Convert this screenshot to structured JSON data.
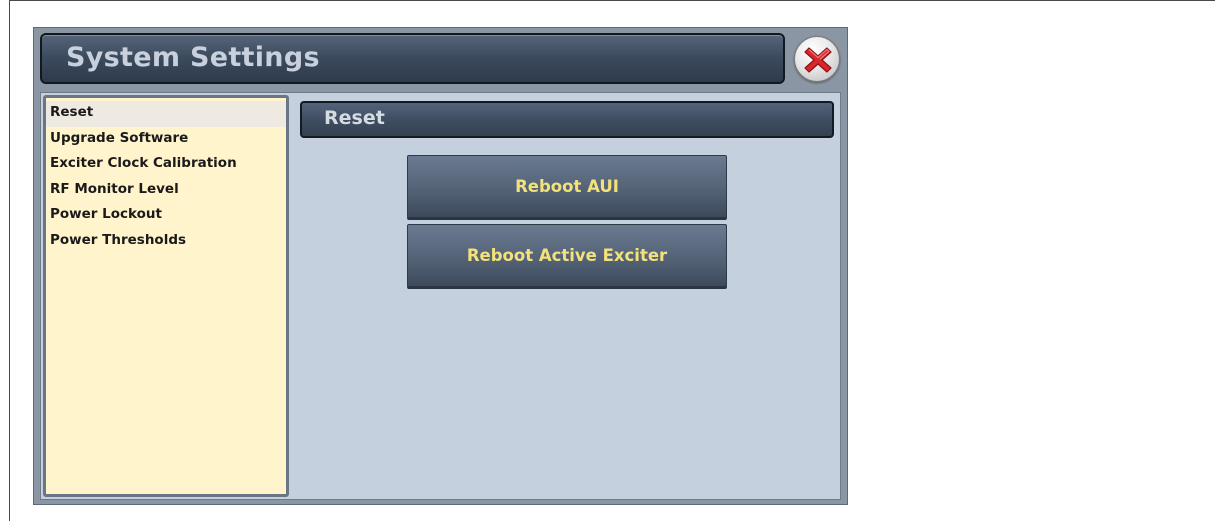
{
  "window": {
    "title": "System Settings",
    "close_icon": "close-x-icon"
  },
  "sidebar": {
    "items": [
      {
        "label": "Reset",
        "selected": true
      },
      {
        "label": "Upgrade Software",
        "selected": false
      },
      {
        "label": "Exciter Clock Calibration",
        "selected": false
      },
      {
        "label": "RF Monitor Level",
        "selected": false
      },
      {
        "label": "Power Lockout",
        "selected": false
      },
      {
        "label": "Power Thresholds",
        "selected": false
      }
    ]
  },
  "main": {
    "section_title": "Reset",
    "buttons": [
      {
        "label": "Reboot AUI"
      },
      {
        "label": "Reboot Active Exciter"
      }
    ]
  },
  "colors": {
    "button_text": "#f3e17a",
    "sidebar_background": "#fff4cc",
    "content_background": "#c5d0de",
    "close_icon_red": "#d8262b"
  }
}
